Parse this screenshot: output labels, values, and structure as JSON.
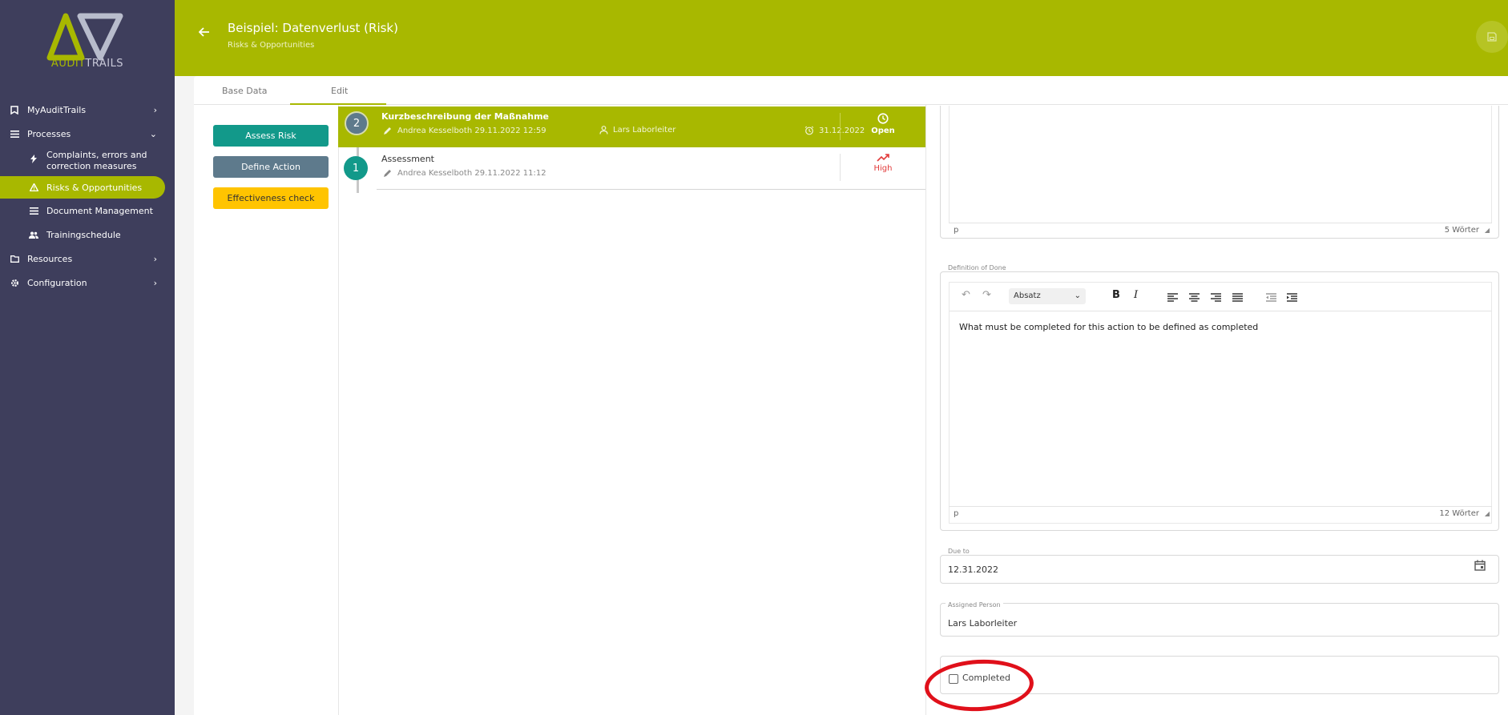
{
  "brand": {
    "logo_text_part1": "AUDIT",
    "logo_text_part2": "TRAILS",
    "accent_color": "#a8b800",
    "sidebar_color": "#3e3e5c"
  },
  "sidebar": {
    "items": [
      {
        "label": "MyAuditTrails",
        "icon": "bookmark-icon"
      },
      {
        "label": "Processes",
        "icon": "list-icon"
      },
      {
        "label": "Complaints, errors and correction measures",
        "icon": "bolt-icon"
      },
      {
        "label": "Risks & Opportunities",
        "icon": "warning-icon"
      },
      {
        "label": "Document Management",
        "icon": "lines-icon"
      },
      {
        "label": "Trainingschedule",
        "icon": "users-icon"
      },
      {
        "label": "Resources",
        "icon": "folder-icon"
      },
      {
        "label": "Configuration",
        "icon": "gear-icon"
      }
    ]
  },
  "header": {
    "title": "Beispiel: Datenverlust (Risk)",
    "subtitle": "Risks & Opportunities"
  },
  "tabs": [
    {
      "label": "Base Data"
    },
    {
      "label": "Edit"
    }
  ],
  "actions": {
    "assess_risk": "Assess Risk",
    "define_action": "Define Action",
    "effectiveness_check": "Effectiveness check"
  },
  "timeline": {
    "entries": [
      {
        "number": "2",
        "title": "Kurzbeschreibung der Maßnahme",
        "author": "Andrea Kesselboth 29.11.2022 12:59",
        "assignee": "Lars Laborleiter",
        "due": "31.12.2022",
        "status": "Open"
      },
      {
        "number": "1",
        "title": "Assessment",
        "author": "Andrea Kesselboth 29.11.2022 11:12",
        "status": "High"
      }
    ]
  },
  "editor_top": {
    "path": "p",
    "word_count": "5 Wörter"
  },
  "definition_of_done": {
    "label": "Definition of Done",
    "format": "Absatz",
    "text": "What must be completed for this action to be defined as completed",
    "path": "p",
    "word_count": "12 Wörter"
  },
  "due_to": {
    "label": "Due to",
    "value": "12.31.2022"
  },
  "assigned_person": {
    "label": "Assigned Person",
    "value": "Lars Laborleiter"
  },
  "completed": {
    "label": "Completed"
  }
}
